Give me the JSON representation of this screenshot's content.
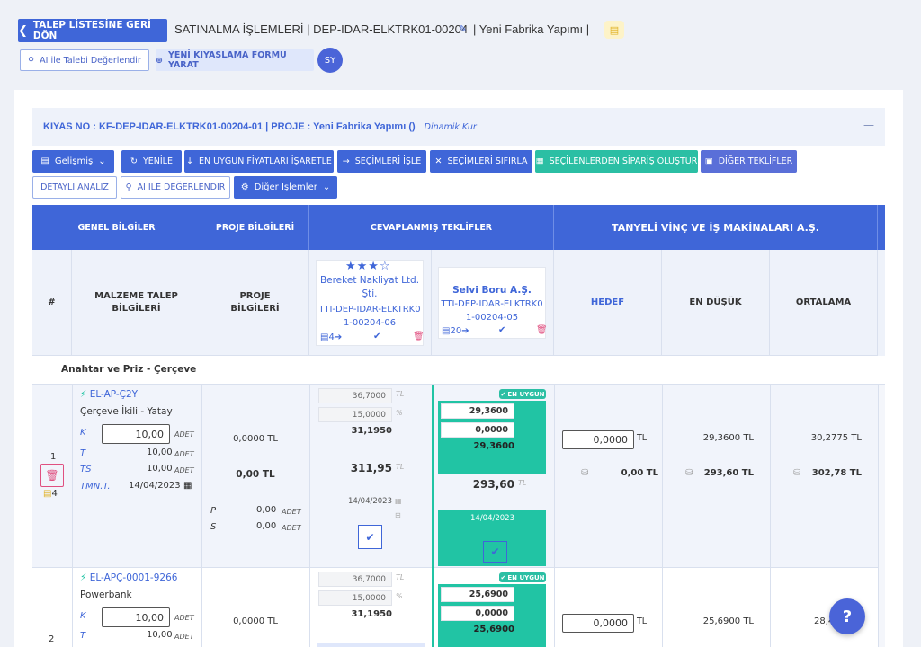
{
  "header": {
    "back_label": "TALEP LİSTESİNE GERİ DÖN",
    "title": "SATINALMA İŞLEMLERİ | DEP-IDAR-ELKTRK01-00204",
    "project": "| Yeni Fabrika Yapımı |",
    "ai_eval_label": "AI ile Talebi Değerlendir",
    "new_form_label": "YENİ KIYASLAMA FORMU YARAT",
    "avatar": "SY"
  },
  "kiyas": {
    "title": "KIYAS NO : KF-DEP-IDAR-ELKTRK01-00204-01 | PROJE : Yeni Fabrika Yapımı ()",
    "kur": "Dinamik Kur",
    "collapse": "—"
  },
  "toolbar": {
    "gelismis": "Gelişmiş",
    "yenile": "YENİLE",
    "en_uygun": "EN UYGUN FİYATLARI İŞARETLE",
    "secimleri_isle": "SEÇİMLERİ İŞLE",
    "secimleri_sifirla": "SEÇİMLERİ SIFIRLA",
    "siparis": "SEÇİLENLERDEN SİPARİŞ OLUŞTUR",
    "diger_teklifler": "DİĞER TEKLİFLER",
    "detayli": "DETAYLI ANALİZ",
    "ai_degerlendir": "AI İLE DEĞERLENDİR",
    "diger_islemler": "Diğer İşlemler"
  },
  "table": {
    "h_genel": "GENEL BİLGİLER",
    "h_proje": "PROJE BİLGİLERİ",
    "h_cevap": "CEVAPLANMIŞ TEKLİFLER",
    "h_vendor": "TANYELİ VİNÇ VE İŞ MAKİNALARI A.Ş.",
    "sub_no": "#",
    "sub_malzeme": "MALZEME TALEP BİLGİLERİ",
    "sub_proje": "PROJE BİLGİLERİ",
    "sub_hedef": "HEDEF",
    "sub_endusuk": "EN DÜŞÜK",
    "sub_ortalama": "ORTALAMA",
    "offer1": {
      "name": "Bereket Nakliyat Ltd. Şti.",
      "code": "TTI-DEP-IDAR-ELKTRK01-00204-06",
      "count": "4",
      "rating": 3.5
    },
    "offer2": {
      "name": "Selvi Boru A.Ş.",
      "code": "TTI-DEP-IDAR-ELKTRK01-00204-05",
      "count": "20"
    },
    "group": "Anahtar ve Priz - Çerçeve",
    "en_uygun": "EN UYGUN",
    "rows": [
      {
        "no": "1",
        "note_count": "4",
        "code": "EL-AP-Ç2Y",
        "name": "Çerçeve İkili - Yatay",
        "k_label": "K",
        "k_value": "10,00",
        "k_unit": "ADET",
        "t_label": "T",
        "t_value": "10,00",
        "t_unit": "ADET",
        "ts_label": "TS",
        "ts_value": "10,00",
        "ts_unit": "ADET",
        "tmnt_label": "TMN.T.",
        "tmnt_value": "14/04/2023",
        "proje_top": "0,0000 TL",
        "proje_total": "0,00 TL",
        "p_label": "P",
        "p_value": "0,00",
        "p_unit": "ADET",
        "s_label": "S",
        "s_value": "0,00",
        "s_unit": "ADET",
        "o1_price": "36,7000",
        "o1_price_unit": "TL",
        "o1_pct": "15,0000",
        "o1_pct_unit": "%",
        "o1_net": "31,1950",
        "o1_total": "311,95",
        "o1_total_unit": "TL",
        "o1_date": "14/04/2023",
        "o2_price": "29,3600",
        "o2_pct": "0,0000",
        "o2_net": "29,3600",
        "o2_total": "293,60",
        "o2_total_unit": "TL",
        "o2_date": "14/04/2023",
        "hedef_value": "0,0000",
        "hedef_unit": "TL",
        "hedef_total": "0,00 TL",
        "endusuk_top": "29,3600 TL",
        "endusuk_total": "293,60 TL",
        "ortalama_top": "30,2775 TL",
        "ortalama_total": "302,78 TL"
      },
      {
        "no": "2",
        "code": "EL-APÇ-0001-9266",
        "name": "Powerbank",
        "k_label": "K",
        "k_value": "10,00",
        "k_unit": "ADET",
        "t_label": "T",
        "t_value": "10,00",
        "t_unit": "ADET",
        "proje_top": "0,0000 TL",
        "o1_price": "36,7000",
        "o1_price_unit": "TL",
        "o1_pct": "15,0000",
        "o1_pct_unit": "%",
        "o1_net": "31,1950",
        "o2_price": "25,6900",
        "o2_pct": "0,0000",
        "o2_net": "25,6900",
        "hedef_value": "0,0000",
        "hedef_unit": "TL",
        "endusuk_top": "25,6900 TL",
        "ortalama_top": "28,4"
      }
    ]
  },
  "help": "?"
}
